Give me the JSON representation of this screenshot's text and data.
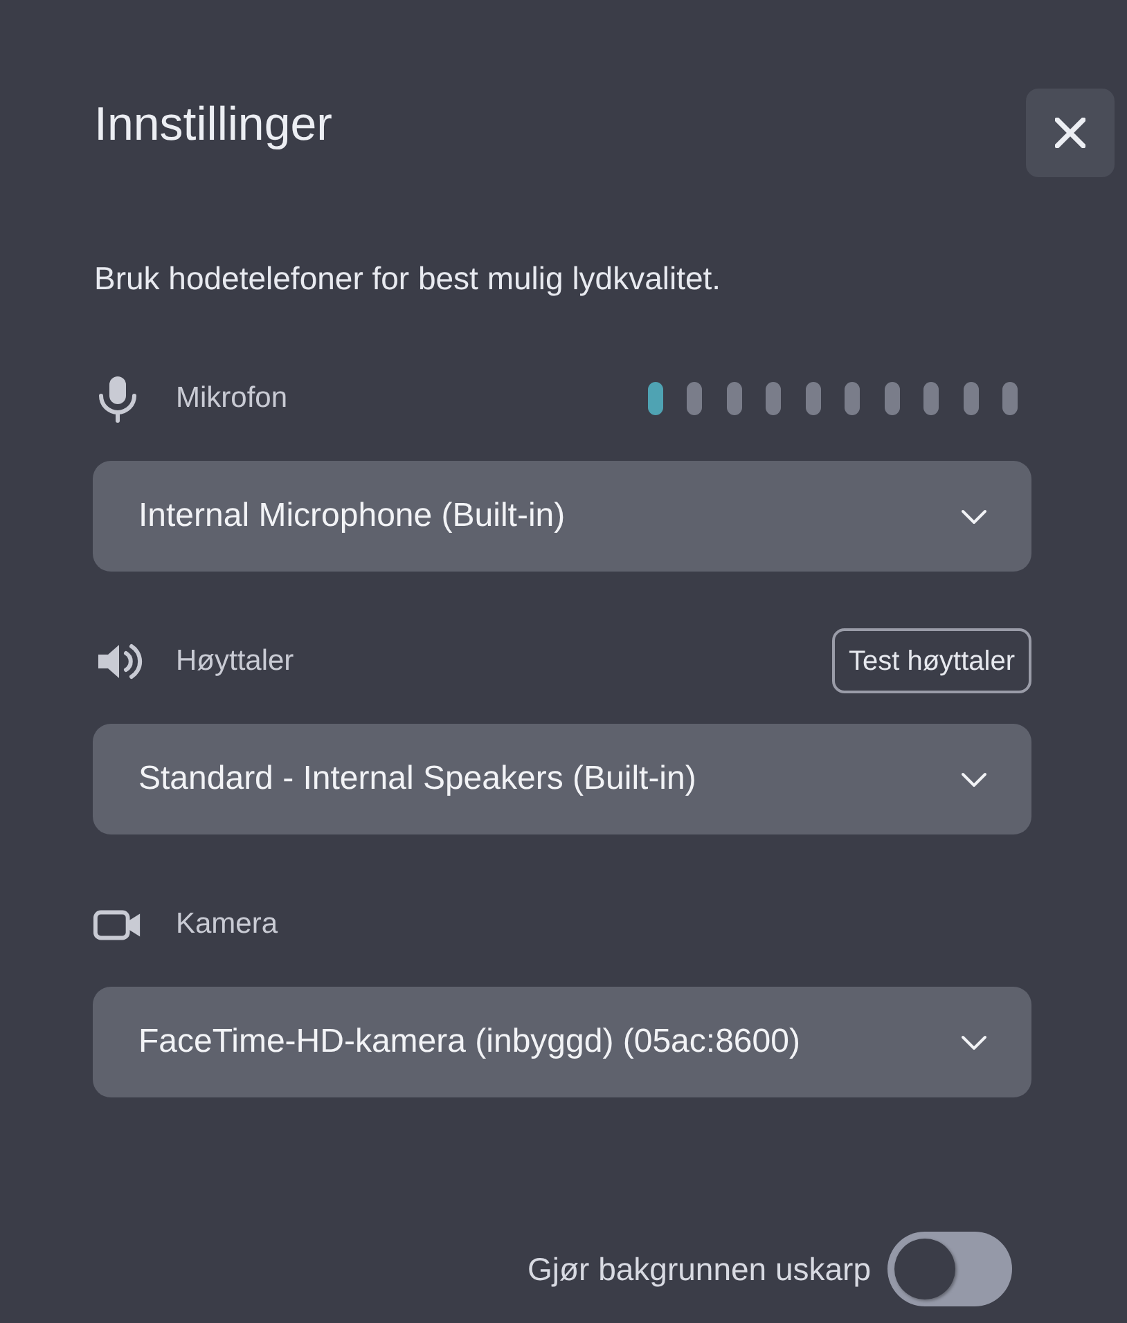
{
  "title": "Innstillinger",
  "hint": "Bruk hodetelefoner for best mulig lydkvalitet.",
  "devices": [
    {
      "kind": "microphone",
      "label": "Mikrofon",
      "meter_segments": [
        {
          "lit": true
        },
        {
          "lit": false
        },
        {
          "lit": false
        },
        {
          "lit": false
        },
        {
          "lit": false
        },
        {
          "lit": false
        },
        {
          "lit": false
        },
        {
          "lit": false
        },
        {
          "lit": false
        },
        {
          "lit": false
        }
      ],
      "value": "Internal Microphone (Built-in)"
    },
    {
      "kind": "speaker",
      "label": "Høyttaler",
      "action": "Test høyttaler",
      "value": "Standard - Internal Speakers (Built-in)"
    },
    {
      "kind": "camera",
      "label": "Kamera",
      "value": "FaceTime-HD-kamera (inbyggd) (05ac:8600)"
    }
  ],
  "blur_toggle": {
    "label": "Gjør bakgrunnen uskarp",
    "on": false
  }
}
